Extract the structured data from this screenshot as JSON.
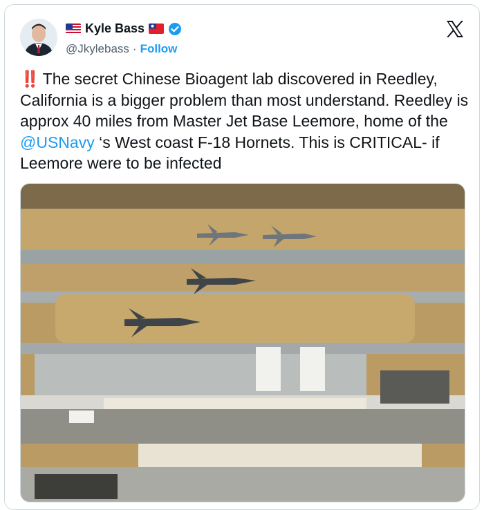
{
  "author": {
    "name": "Kyle Bass",
    "handle": "@Jkylebass",
    "separator": "·",
    "follow_label": "Follow",
    "verified_color": "#1d9bf0",
    "name_flags": [
      "us-flag-icon",
      "taiwan-flag-icon"
    ]
  },
  "tweet": {
    "emoji": "‼️",
    "text_part1": "The secret Chinese Bioagent lab discovered in Reedley, California is a bigger problem than most understand. Reedley is approx 40 miles from Master Jet Base Leemore, home of the ",
    "mention": "@USNavy",
    "text_part2": " ‘s West coast F-18 Hornets. This is CRITICAL- if Leemore were to be infected"
  },
  "media": {
    "icon": "aerial-photo-jets-over-airbase"
  },
  "colors": {
    "link": "#1d9bf0",
    "muted": "#536471",
    "border": "#cfd9de"
  }
}
